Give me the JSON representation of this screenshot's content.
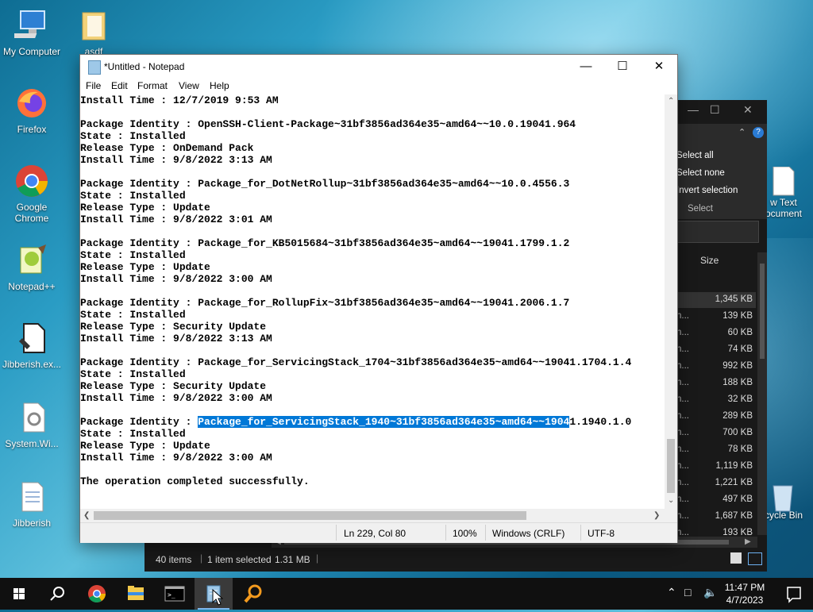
{
  "desktop": {
    "icons": [
      {
        "label": "My Computer"
      },
      {
        "label": "asdf"
      },
      {
        "label": "Firefox"
      },
      {
        "label": "Google Chrome"
      },
      {
        "label": "Notepad++"
      },
      {
        "label": "Jibberish.ex..."
      },
      {
        "label": "System.Wi..."
      },
      {
        "label": "Jibberish"
      },
      {
        "label": "w Text ocument"
      },
      {
        "label": "cycle Bin"
      }
    ]
  },
  "explorer": {
    "ribbon": {
      "select_all": "Select all",
      "select_none": "Select none",
      "invert_selection": "Invert selection",
      "group": "Select"
    },
    "column_size": "Size",
    "rows": [
      {
        "name": "",
        "size": "1,345 KB"
      },
      {
        "name": "n...",
        "size": "139 KB"
      },
      {
        "name": "n...",
        "size": "60 KB"
      },
      {
        "name": "n...",
        "size": "74 KB"
      },
      {
        "name": "n...",
        "size": "992 KB"
      },
      {
        "name": "n...",
        "size": "188 KB"
      },
      {
        "name": "n...",
        "size": "32 KB"
      },
      {
        "name": "n...",
        "size": "289 KB"
      },
      {
        "name": "n...",
        "size": "700 KB"
      },
      {
        "name": "n...",
        "size": "78 KB"
      },
      {
        "name": "n...",
        "size": "1,119 KB"
      },
      {
        "name": "n...",
        "size": "1,221 KB"
      },
      {
        "name": "n...",
        "size": "497 KB"
      },
      {
        "name": "n...",
        "size": "1,687 KB"
      },
      {
        "name": "n...",
        "size": "193 KB"
      }
    ],
    "status": {
      "items": "40 items",
      "selected": "1 item selected",
      "size": "1.31 MB"
    }
  },
  "notepad": {
    "title": "*Untitled - Notepad",
    "menu": [
      "File",
      "Edit",
      "Format",
      "View",
      "Help"
    ],
    "lines": [
      "Install Time : 12/7/2019 9:53 AM",
      "",
      "Package Identity : OpenSSH-Client-Package~31bf3856ad364e35~amd64~~10.0.19041.964",
      "State : Installed",
      "Release Type : OnDemand Pack",
      "Install Time : 9/8/2022 3:13 AM",
      "",
      "Package Identity : Package_for_DotNetRollup~31bf3856ad364e35~amd64~~10.0.4556.3",
      "State : Installed",
      "Release Type : Update",
      "Install Time : 9/8/2022 3:01 AM",
      "",
      "Package Identity : Package_for_KB5015684~31bf3856ad364e35~amd64~~19041.1799.1.2",
      "State : Installed",
      "Release Type : Update",
      "Install Time : 9/8/2022 3:00 AM",
      "",
      "Package Identity : Package_for_RollupFix~31bf3856ad364e35~amd64~~19041.2006.1.7",
      "State : Installed",
      "Release Type : Security Update",
      "Install Time : 9/8/2022 3:13 AM",
      "",
      "Package Identity : Package_for_ServicingStack_1704~31bf3856ad364e35~amd64~~19041.1704.1.4",
      "State : Installed",
      "Release Type : Security Update",
      "Install Time : 9/8/2022 3:00 AM",
      "",
      "",
      "State : Installed",
      "Release Type : Update",
      "Install Time : 9/8/2022 3:00 AM",
      "",
      "The operation completed successfully."
    ],
    "selected_line": {
      "before": "Package Identity : ",
      "selected": "Package_for_ServicingStack_1940~31bf3856ad364e35~amd64~~1904",
      "after": "1.1940.1.0"
    },
    "status": {
      "position": "Ln 229, Col 80",
      "zoom": "100%",
      "line_ending": "Windows (CRLF)",
      "encoding": "UTF-8"
    }
  },
  "taskbar": {
    "time": "11:47 PM",
    "date": "4/7/2023"
  }
}
